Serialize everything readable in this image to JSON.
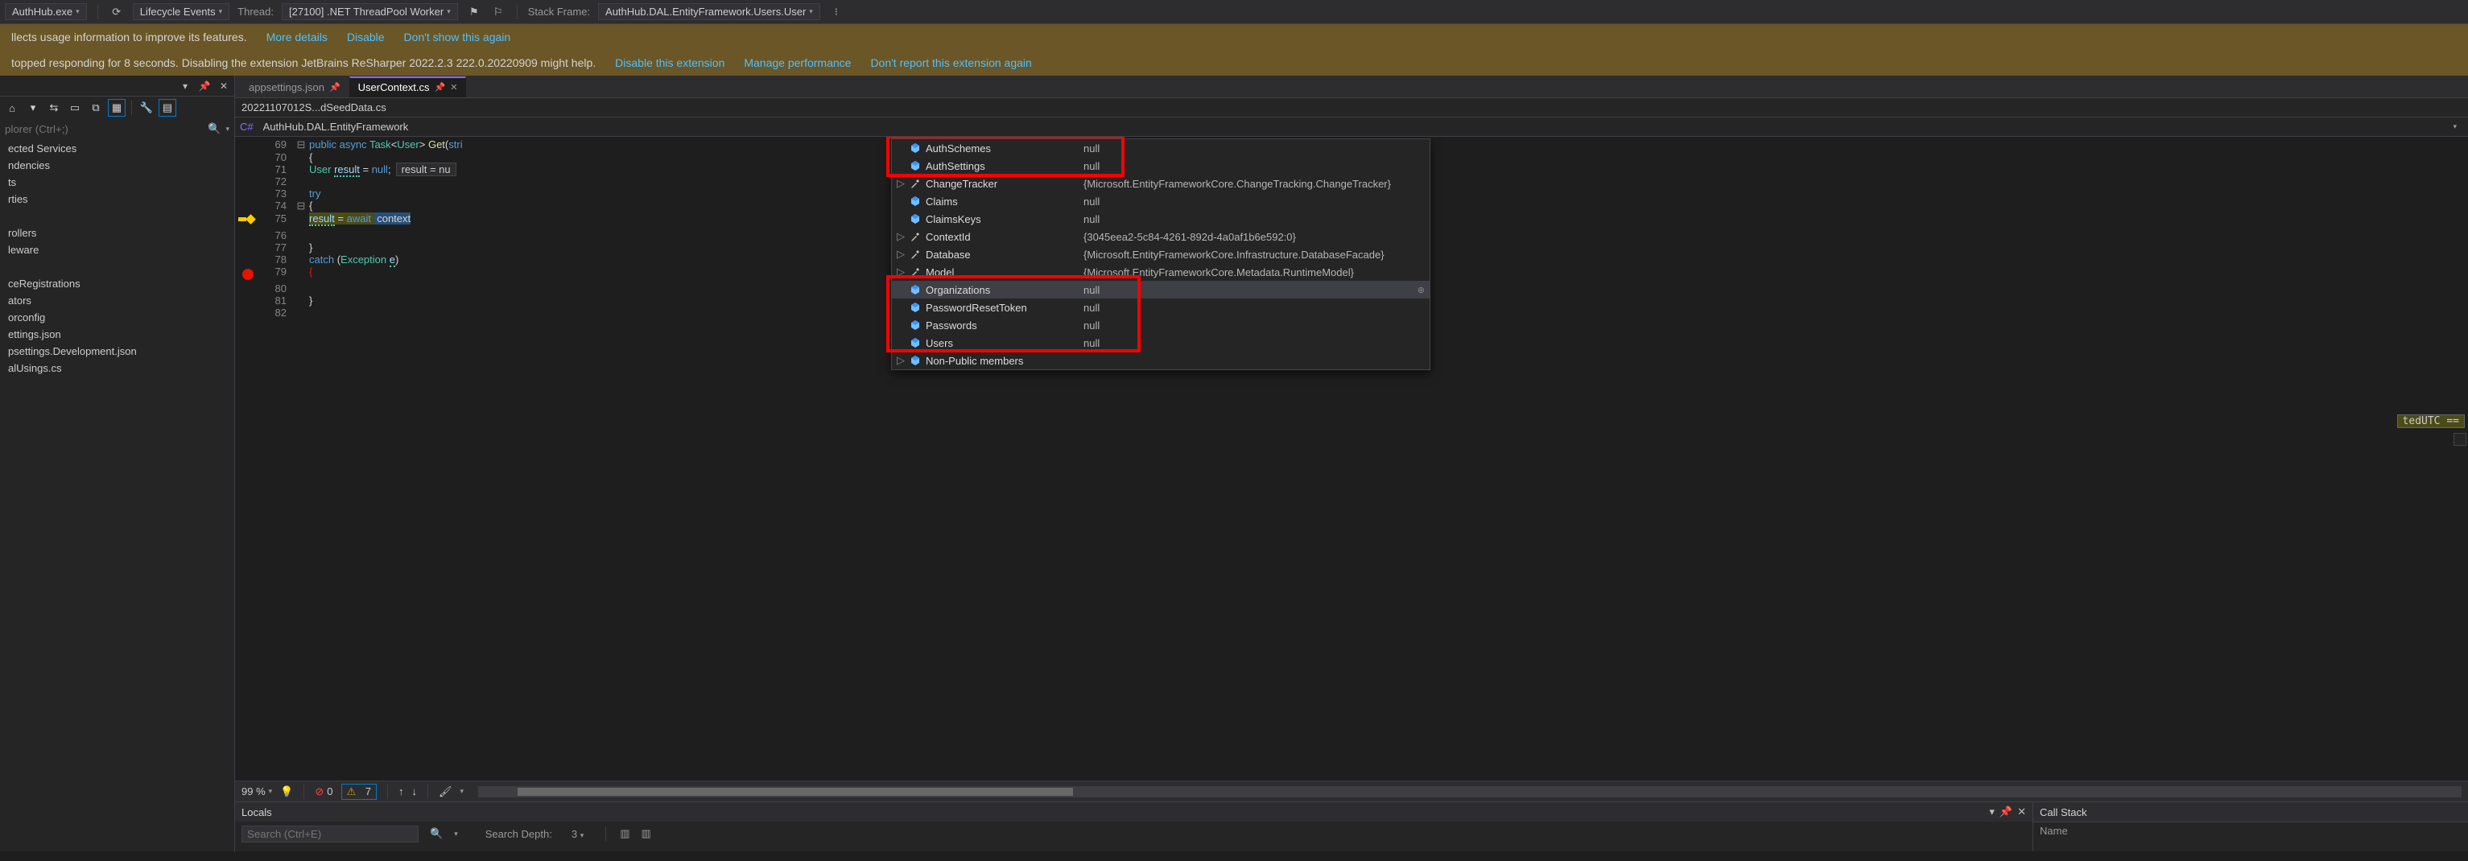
{
  "debugToolbar": {
    "process": "AuthHub.exe",
    "lifecycle": "Lifecycle Events",
    "threadLabel": "Thread:",
    "thread": "[27100] .NET ThreadPool Worker",
    "stackLabel": "Stack Frame:",
    "stackFrame": "AuthHub.DAL.EntityFramework.Users.User"
  },
  "infoBars": {
    "usage": {
      "text": "llects usage information to improve its features.",
      "links": [
        "More details",
        "Disable",
        "Don't show this again"
      ]
    },
    "extWarn": {
      "text": "topped responding for 8 seconds. Disabling the extension JetBrains ReSharper 2022.2.3 222.0.20220909 might help.",
      "links": [
        "Disable this extension",
        "Manage performance",
        "Don't report this extension again"
      ]
    }
  },
  "solutionExplorer": {
    "searchPlaceholder": "plorer (Ctrl+;)",
    "items": [
      "ected Services",
      "ndencies",
      "ts",
      "rties",
      "",
      "rollers",
      "leware",
      "",
      "ceRegistrations",
      "ators",
      "orconfig",
      "ettings.json",
      "psettings.Development.json",
      "alUsings.cs"
    ]
  },
  "tabs": {
    "inactive": "appsettings.json",
    "active": "UserContext.cs",
    "breadcrumb": "20221107012S...dSeedData.cs"
  },
  "navBar": {
    "namespace": "AuthHub.DAL.EntityFramework"
  },
  "editor": {
    "lines": [
      {
        "ln": 69,
        "fold": "⊟",
        "html": "<span class='kw'>public</span> <span class='kw'>async</span> <span class='typ'>Task</span>&lt;<span class='typ'>User</span>&gt; <span class='mtd'>Get</span>(<span class='kw'>stri</span>"
      },
      {
        "ln": 70,
        "html": "{"
      },
      {
        "ln": 71,
        "html": "    <span class='typ'>User</span> <span class='ident squig'>result</span> = <span class='kw'>null</span>;",
        "tip": "result = nu"
      },
      {
        "ln": 72,
        "html": ""
      },
      {
        "ln": 73,
        "html": "    <span class='kw'>try</span>"
      },
      {
        "ln": 74,
        "fold": "⊟",
        "html": "    {"
      },
      {
        "ln": 75,
        "bp": "arrow",
        "html": "        <span class='hl-line'><span class='ident squig'>result</span> = <span class='kw'>await</span> <span class='sel'>&nbsp;context</span></span>"
      },
      {
        "ln": 76,
        "html": ""
      },
      {
        "ln": 77,
        "html": "    }"
      },
      {
        "ln": 78,
        "html": "    <span class='kw'>catch</span> (<span class='typ'>Exception</span> <span class='ident squig'>e</span>)"
      },
      {
        "ln": 79,
        "bp": "dot",
        "html": "    <span style='color:#e51400'>{</span>"
      },
      {
        "ln": 80,
        "html": ""
      },
      {
        "ln": 81,
        "html": "    }"
      },
      {
        "ln": 82,
        "fold": "",
        "html": ""
      }
    ],
    "rightFloat": "tedUTC =="
  },
  "datatip": {
    "rows": [
      {
        "icon": "cube",
        "name": "AuthSchemes",
        "val": "null"
      },
      {
        "icon": "cube",
        "name": "AuthSettings",
        "val": "null"
      },
      {
        "icon": "wrench",
        "name": "ChangeTracker",
        "val": "{Microsoft.EntityFrameworkCore.ChangeTracking.ChangeTracker}",
        "expander": "▷"
      },
      {
        "icon": "cube",
        "name": "Claims",
        "val": "null"
      },
      {
        "icon": "cube",
        "name": "ClaimsKeys",
        "val": "null"
      },
      {
        "icon": "wrench",
        "name": "ContextId",
        "val": "{3045eea2-5c84-4261-892d-4a0af1b6e592:0}",
        "expander": "▷"
      },
      {
        "icon": "wrench",
        "name": "Database",
        "val": "{Microsoft.EntityFrameworkCore.Infrastructure.DatabaseFacade}",
        "expander": "▷"
      },
      {
        "icon": "wrench",
        "name": "Model",
        "val": "{Microsoft.EntityFrameworkCore.Metadata.RuntimeModel}",
        "expander": "▷"
      },
      {
        "icon": "cube",
        "name": "Organizations",
        "val": "null",
        "hovered": true,
        "pin": true
      },
      {
        "icon": "cube",
        "name": "PasswordResetToken",
        "val": "null"
      },
      {
        "icon": "cube",
        "name": "Passwords",
        "val": "null"
      },
      {
        "icon": "cube",
        "name": "Users",
        "val": "null"
      },
      {
        "icon": "cube",
        "name": "Non-Public members",
        "val": "",
        "expander": "▷"
      }
    ]
  },
  "editorStatus": {
    "zoom": "99 %",
    "errors": "0",
    "warnings": "7"
  },
  "locals": {
    "title": "Locals",
    "searchPlaceholder": "Search (Ctrl+E)",
    "depthLabel": "Search Depth:",
    "depth": "3"
  },
  "callStack": {
    "title": "Call Stack",
    "col": "Name"
  }
}
